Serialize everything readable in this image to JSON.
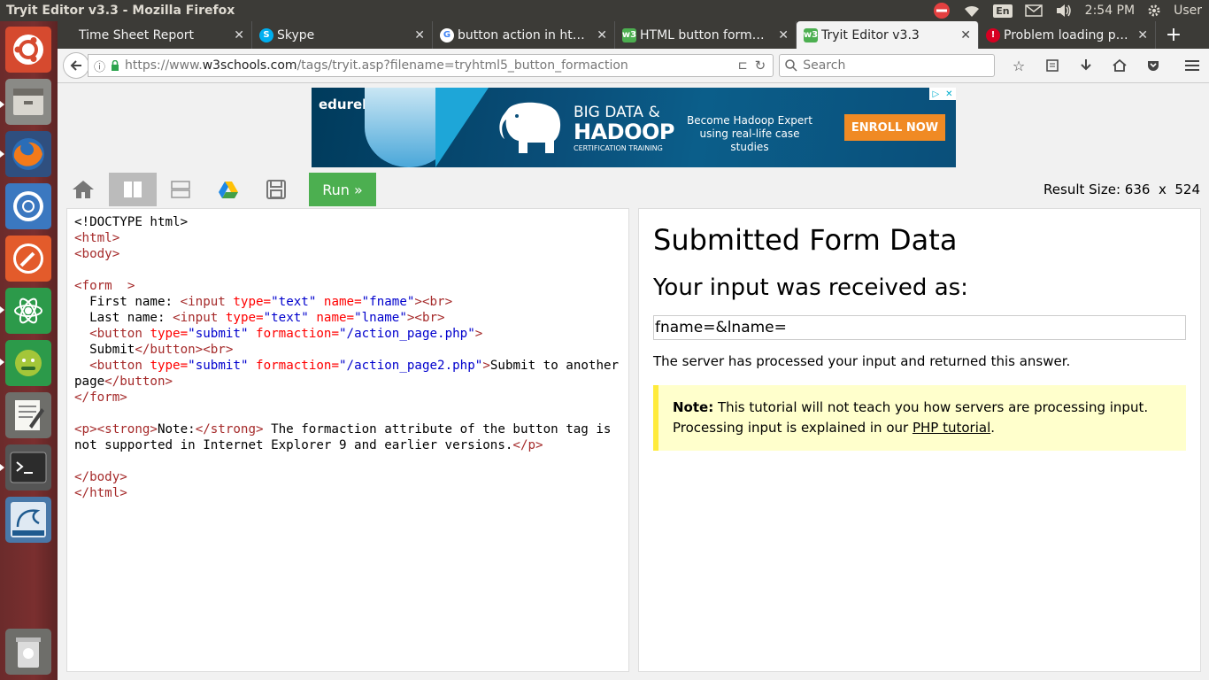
{
  "os": {
    "window_title": "Tryit Editor v3.3 - Mozilla Firefox",
    "keyboard_lang": "En",
    "clock": "2:54 PM",
    "user": "User"
  },
  "browser": {
    "tabs": [
      {
        "label": "Time Sheet Report",
        "icon": "none",
        "active": false
      },
      {
        "label": "Skype",
        "icon": "skype-icon",
        "active": false
      },
      {
        "label": "button action in ht…",
        "icon": "google-icon",
        "active": false
      },
      {
        "label": "HTML button form…",
        "icon": "w3schools-icon",
        "active": false
      },
      {
        "label": "Tryit Editor v3.3",
        "icon": "w3schools-icon",
        "active": true
      },
      {
        "label": "Problem loading page",
        "icon": "warning-icon",
        "active": false
      }
    ],
    "url_prefix": "https://www.",
    "url_host": "w3schools.com",
    "url_path": "/tags/tryit.asp?filename=tryhtml5_button_formaction",
    "search_placeholder": "Search"
  },
  "ad": {
    "brand": "edureka!",
    "headline_top": "BIG DATA &",
    "headline_main": "HADOOP",
    "subline": "CERTIFICATION TRAINING",
    "tagline": "Become Hadoop Expert using real-life case studies",
    "cta": "ENROLL NOW"
  },
  "toolbar": {
    "run_label": "Run »",
    "result_size_label": "Result Size: 636  x  524"
  },
  "result": {
    "title": "Submitted Form Data",
    "subtitle": "Your input was received as:",
    "received": "fname=&lname=",
    "message": "The server has processed your input and returned this answer.",
    "note_bold": "Note:",
    "note_text": " This tutorial will not teach you how servers are processing input. Processing input is explained in our ",
    "note_link": "PHP tutorial",
    "note_end": "."
  },
  "code": {
    "doctype": "<!DOCTYPE html>",
    "fname_label": "First name: ",
    "lname_label": "Last name: ",
    "submit_label": "Submit",
    "submit2_label": "Submit to another page",
    "note_label": "Note:",
    "note_text": " The formaction attribute of the button tag is not supported in Internet Explorer 9 and earlier versions."
  }
}
